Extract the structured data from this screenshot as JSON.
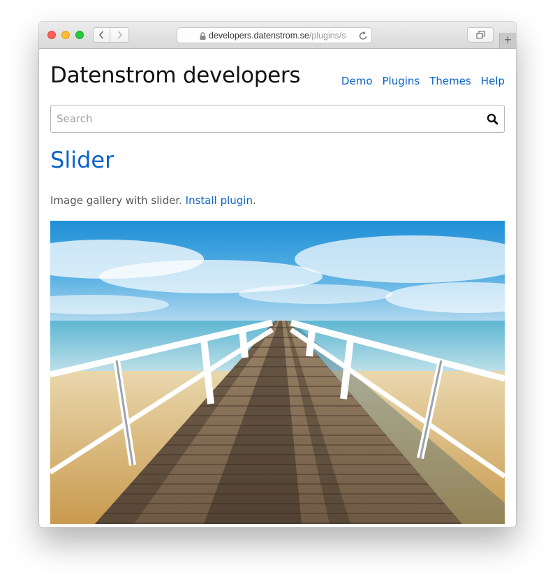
{
  "browser": {
    "url_host": "developers.datenstrom.se",
    "url_path": "/plugins/s"
  },
  "site": {
    "title": "Datenstrom developers",
    "nav": [
      {
        "label": "Demo"
      },
      {
        "label": "Plugins"
      },
      {
        "label": "Themes"
      },
      {
        "label": "Help"
      }
    ]
  },
  "search": {
    "placeholder": "Search",
    "value": ""
  },
  "page": {
    "title": "Slider",
    "description": "Image gallery with slider.",
    "install_link": "Install plugin",
    "after_link": "."
  },
  "icons": {
    "back": "chevron-left-icon",
    "forward": "chevron-right-icon",
    "lock": "lock-icon",
    "reload": "reload-icon",
    "tabs": "tabs-overview-icon",
    "new_tab": "plus-icon",
    "search": "magnifier-icon"
  },
  "colors": {
    "link": "#0a63c9",
    "close": "#fc5f57",
    "minimize": "#fdbc2e",
    "zoom": "#28c840"
  }
}
